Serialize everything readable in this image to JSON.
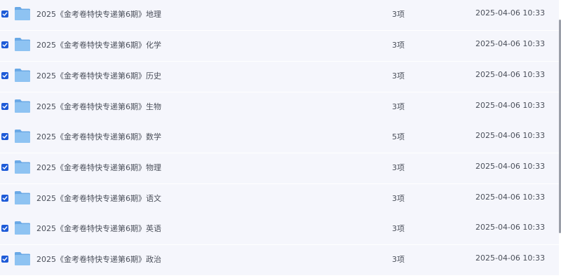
{
  "rows": [
    {
      "name": "2025《金考卷特快专递第6期》地理",
      "count": "3项",
      "date": "2025-04-06 10:33",
      "checked": true
    },
    {
      "name": "2025《金考卷特快专递第6期》化学",
      "count": "3项",
      "date": "2025-04-06 10:33",
      "checked": true
    },
    {
      "name": "2025《金考卷特快专递第6期》历史",
      "count": "3项",
      "date": "2025-04-06 10:33",
      "checked": true
    },
    {
      "name": "2025《金考卷特快专递第6期》生物",
      "count": "3项",
      "date": "2025-04-06 10:33",
      "checked": true
    },
    {
      "name": "2025《金考卷特快专递第6期》数学",
      "count": "5项",
      "date": "2025-04-06 10:33",
      "checked": true
    },
    {
      "name": "2025《金考卷特快专递第6期》物理",
      "count": "3项",
      "date": "2025-04-06 10:33",
      "checked": true
    },
    {
      "name": "2025《金考卷特快专递第6期》语文",
      "count": "3项",
      "date": "2025-04-06 10:33",
      "checked": true
    },
    {
      "name": "2025《金考卷特快专递第6期》英语",
      "count": "3项",
      "date": "2025-04-06 10:33",
      "checked": true
    },
    {
      "name": "2025《金考卷特快专递第6期》政治",
      "count": "3项",
      "date": "2025-04-06 10:33",
      "checked": true
    }
  ],
  "icons": {
    "row_icon": "folder-icon",
    "checkbox_icon": "checkmark-icon"
  },
  "colors": {
    "row_background": "#f5f6fc",
    "checkbox": "#1e5bd8",
    "folder_body": "#8ec3f2",
    "folder_tab": "#6aa9e6",
    "text": "#4a4f5a"
  }
}
